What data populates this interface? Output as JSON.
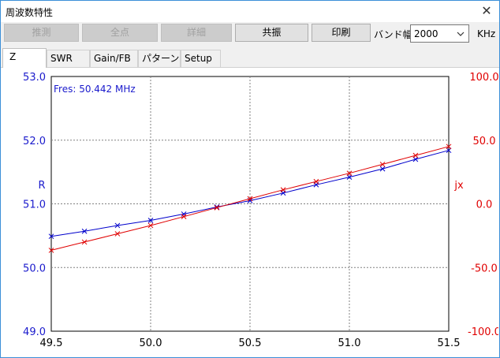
{
  "window": {
    "title": "周波数特性",
    "close_glyph": "✕"
  },
  "toolbar": {
    "estimate_label": "推測",
    "all_points_label": "全点",
    "detail_label": "詳細",
    "resonance_label": "共振",
    "print_label": "印刷",
    "band_width_label": "バンド幅",
    "band_width_value": "2000",
    "unit_label": "KHz"
  },
  "tabs": [
    {
      "label": "Z",
      "active": true
    },
    {
      "label": "SWR",
      "active": false
    },
    {
      "label": "Gain/FB",
      "active": false
    },
    {
      "label": "パターン",
      "active": false
    },
    {
      "label": "Setup",
      "active": false
    }
  ],
  "colors": {
    "r_series": "#0000cc",
    "jx_series": "#e00000",
    "left_axis": "#1a1acc",
    "right_axis": "#e00000",
    "grid": "#808080"
  },
  "chart_data": {
    "type": "line",
    "annotation": "Fres: 50.442 MHz",
    "xlabel": "",
    "xlim": [
      49.5,
      51.5
    ],
    "x_ticks": [
      "49.5",
      "50.0",
      "50.5",
      "51.0",
      "51.5"
    ],
    "x_tick_values": [
      49.5,
      50.0,
      50.5,
      51.0,
      51.5
    ],
    "left_axis": {
      "label": "R",
      "ylim": [
        49.0,
        53.0
      ],
      "ticks": [
        "49.0",
        "50.0",
        "51.0",
        "52.0",
        "53.0"
      ],
      "tick_values": [
        49.0,
        50.0,
        51.0,
        52.0,
        53.0
      ]
    },
    "right_axis": {
      "label": "jx",
      "ylim": [
        -100.0,
        100.0
      ],
      "ticks": [
        "-100.0",
        "-50.0",
        "0.0",
        "50.0",
        "100.0"
      ],
      "tick_values": [
        -100.0,
        -50.0,
        0.0,
        50.0,
        100.0
      ]
    },
    "grid": true,
    "series": [
      {
        "name": "R",
        "axis": "left",
        "x": [
          49.5,
          49.667,
          49.833,
          50.0,
          50.167,
          50.333,
          50.5,
          50.667,
          50.833,
          51.0,
          51.167,
          51.333,
          51.5
        ],
        "values": [
          50.49,
          50.57,
          50.66,
          50.74,
          50.84,
          50.95,
          51.05,
          51.17,
          51.3,
          51.42,
          51.55,
          51.7,
          51.84
        ]
      },
      {
        "name": "jx",
        "axis": "right",
        "x": [
          49.5,
          49.667,
          49.833,
          50.0,
          50.167,
          50.333,
          50.5,
          50.667,
          50.833,
          51.0,
          51.167,
          51.333,
          51.5
        ],
        "values": [
          -36.5,
          -30.0,
          -23.5,
          -17.0,
          -10.0,
          -3.0,
          4.0,
          11.0,
          17.5,
          24.0,
          31.0,
          38.0,
          45.0
        ]
      }
    ]
  }
}
